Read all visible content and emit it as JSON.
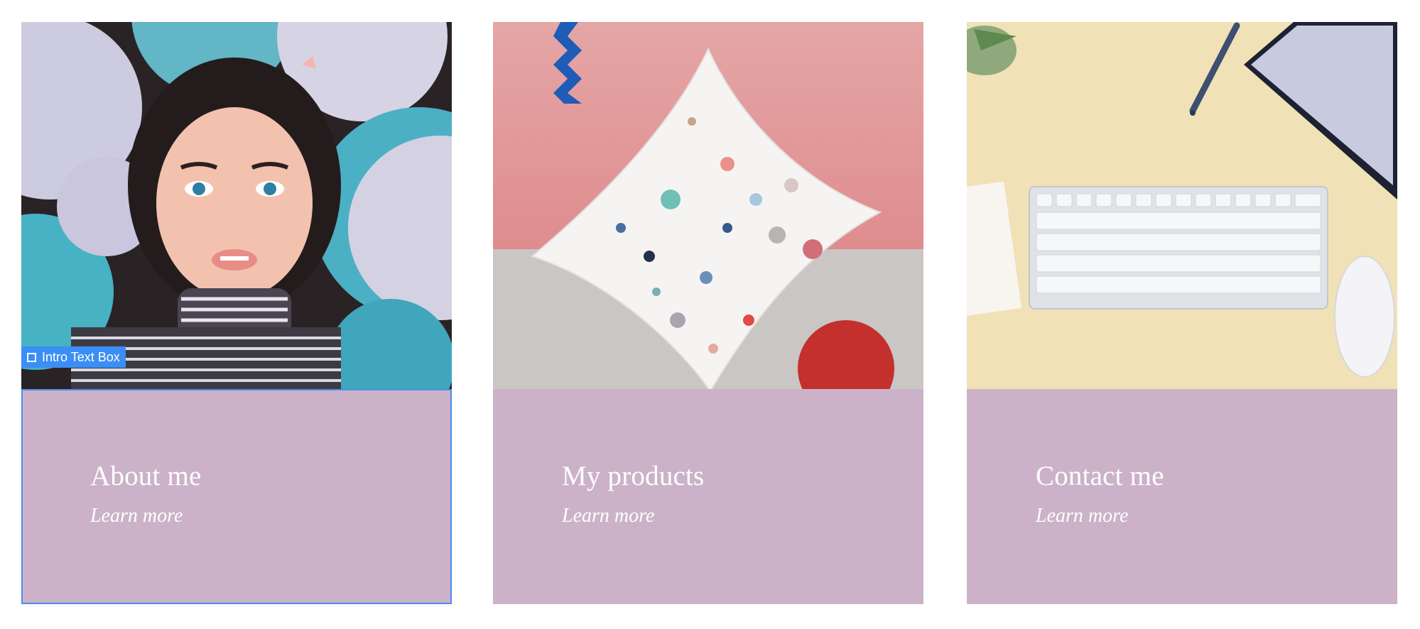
{
  "cards": [
    {
      "title": "About me",
      "link": "Learn more",
      "image": "woman-with-balloons-photo"
    },
    {
      "title": "My products",
      "link": "Learn more",
      "image": "terrazzo-pillow-photo"
    },
    {
      "title": "Contact me",
      "link": "Learn more",
      "image": "keyboard-desk-photo"
    }
  ],
  "editor": {
    "selection_label": "Intro Text Box",
    "selection_icon": "square-outline-icon"
  },
  "colors": {
    "panel": "#cbb2c9",
    "selection": "#3a8ef5",
    "text": "#ffffff"
  }
}
